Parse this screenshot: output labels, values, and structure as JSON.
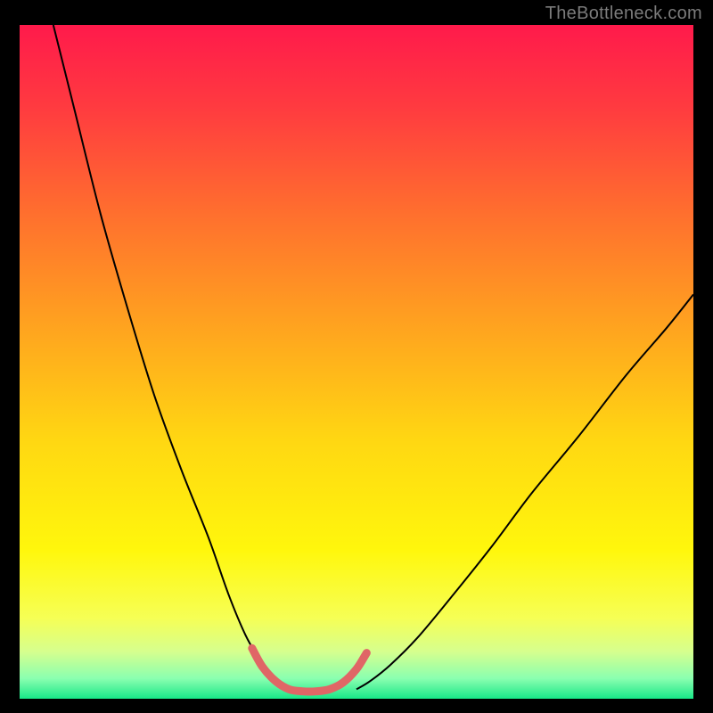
{
  "watermark": "TheBottleneck.com",
  "chart_data": {
    "type": "line",
    "title": "",
    "xlabel": "",
    "ylabel": "",
    "xlim": [
      0,
      100
    ],
    "ylim": [
      0,
      100
    ],
    "grid": false,
    "legend": false,
    "background_gradient": {
      "stops": [
        {
          "offset": 0.0,
          "color": "#ff1a4b"
        },
        {
          "offset": 0.12,
          "color": "#ff3a40"
        },
        {
          "offset": 0.28,
          "color": "#ff6f2e"
        },
        {
          "offset": 0.45,
          "color": "#ffa41f"
        },
        {
          "offset": 0.62,
          "color": "#ffd812"
        },
        {
          "offset": 0.78,
          "color": "#fff70c"
        },
        {
          "offset": 0.88,
          "color": "#f6ff55"
        },
        {
          "offset": 0.93,
          "color": "#d6ff8e"
        },
        {
          "offset": 0.97,
          "color": "#8affb0"
        },
        {
          "offset": 1.0,
          "color": "#18e788"
        }
      ]
    },
    "series": [
      {
        "name": "bottleneck-curve-left",
        "stroke": "#000000",
        "x": [
          5,
          8,
          12,
          16,
          20,
          24,
          28,
          31,
          33.5,
          35.5,
          37,
          38.5,
          40
        ],
        "y": [
          100,
          88,
          72,
          58,
          45,
          34,
          24,
          15.5,
          9.5,
          6,
          3.8,
          2.3,
          1.4
        ]
      },
      {
        "name": "bottleneck-curve-right",
        "stroke": "#000000",
        "x": [
          50,
          52,
          55,
          59,
          64,
          70,
          76,
          83,
          90,
          96,
          100
        ],
        "y": [
          1.4,
          2.6,
          5,
          9,
          15,
          22.5,
          30.5,
          39,
          48,
          55,
          60
        ]
      },
      {
        "name": "bottleneck-floor-highlight",
        "stroke": "#e06666",
        "stroke_width": 9,
        "linecap": "round",
        "x": [
          34.5,
          36,
          38,
          40,
          42,
          44,
          46,
          48,
          50,
          51.5
        ],
        "y": [
          7.5,
          4.8,
          2.6,
          1.4,
          1.1,
          1.1,
          1.4,
          2.4,
          4.4,
          6.8
        ]
      }
    ]
  }
}
